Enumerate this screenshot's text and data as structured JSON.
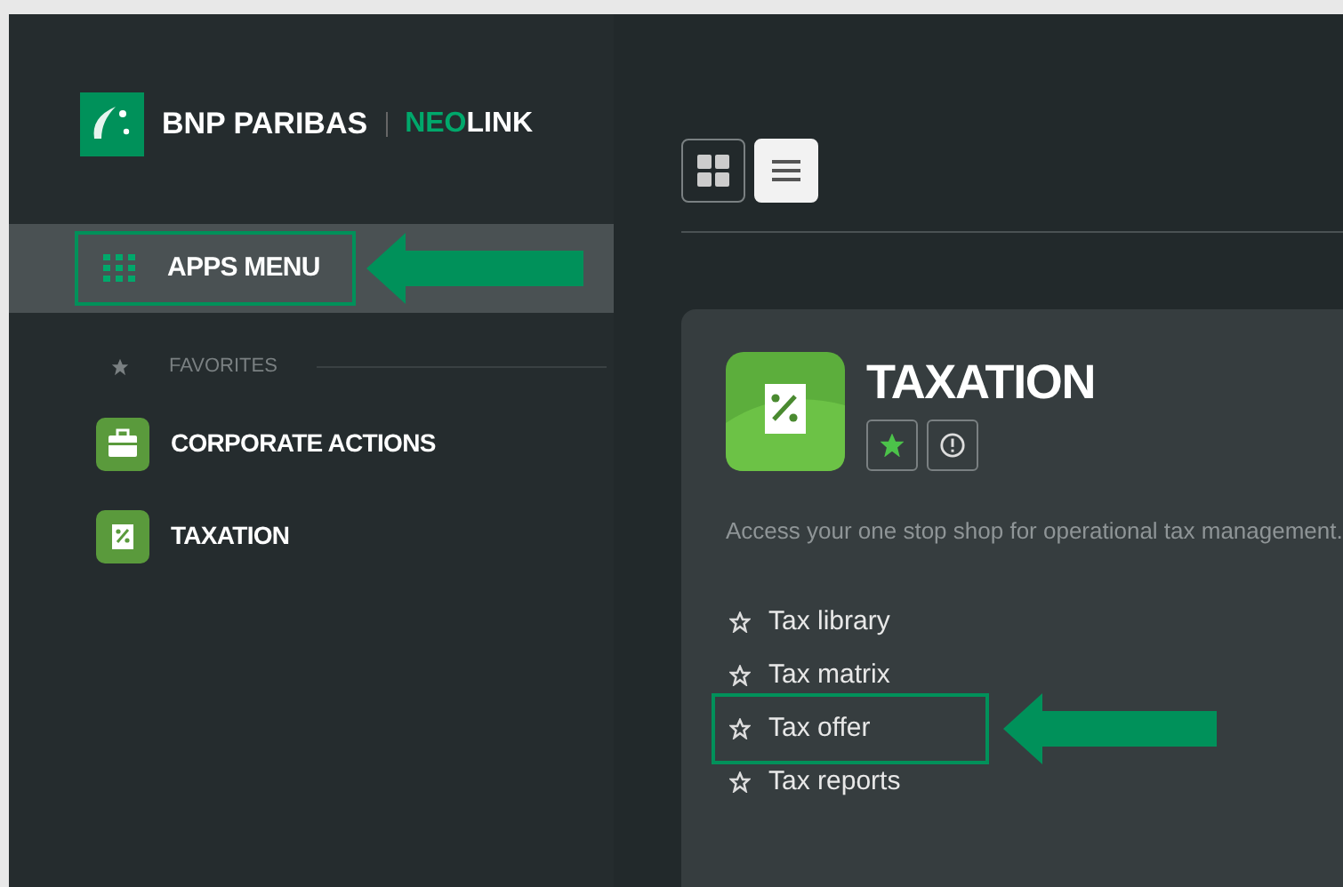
{
  "sidebar": {
    "brand": {
      "name": "BNP PARIBAS",
      "product_accent": "NEO",
      "product_rest": "LINK"
    },
    "apps_menu": {
      "label": "APPS MENU",
      "selected": true,
      "highlighted": true
    },
    "favorites_label": "FAVORITES",
    "favorites": [
      {
        "label": "CORPORATE ACTIONS",
        "kind": "briefcase"
      },
      {
        "label": "TAXATION",
        "kind": "receipt"
      }
    ]
  },
  "view_toggle": [
    {
      "kind": "grid",
      "selected": false
    },
    {
      "kind": "list",
      "selected": true
    }
  ],
  "app_card": {
    "title": "TAXATION",
    "favorite": true,
    "description": "Access your one stop shop for operational tax management.",
    "links": [
      {
        "label": "Tax library",
        "highlighted": false
      },
      {
        "label": "Tax matrix",
        "highlighted": false
      },
      {
        "label": "Tax offer",
        "highlighted": true
      },
      {
        "label": "Tax reports",
        "highlighted": false
      }
    ]
  }
}
